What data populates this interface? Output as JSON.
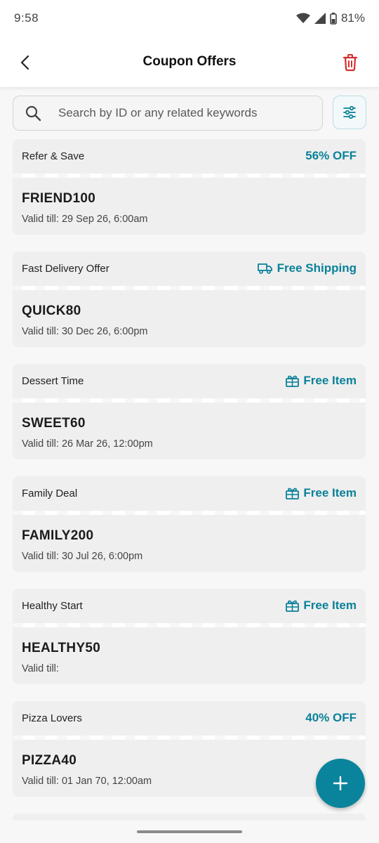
{
  "status_bar": {
    "time": "9:58",
    "battery": "81%"
  },
  "header": {
    "title": "Coupon Offers",
    "back_icon": "chevron-left-icon",
    "delete_icon": "trash-icon"
  },
  "search": {
    "placeholder": "Search by ID or any related keywords",
    "value": ""
  },
  "colors": {
    "accent": "#0a8199",
    "delete": "#d32f2f",
    "card": "#efefef",
    "fab": "#0a849c"
  },
  "coupons": [
    {
      "name": "Refer & Save",
      "offer": "56% OFF",
      "offer_icon": "",
      "code": "FRIEND100",
      "valid": "Valid till: 29 Sep 26, 6:00am"
    },
    {
      "name": "Fast Delivery Offer",
      "offer": "Free Shipping",
      "offer_icon": "truck-icon",
      "code": "QUICK80",
      "valid": "Valid till: 30 Dec 26, 6:00pm"
    },
    {
      "name": "Dessert Time",
      "offer": "Free Item",
      "offer_icon": "gift-icon",
      "code": "SWEET60",
      "valid": "Valid till: 26 Mar 26, 12:00pm"
    },
    {
      "name": "Family Deal",
      "offer": "Free Item",
      "offer_icon": "gift-icon",
      "code": "FAMILY200",
      "valid": "Valid till: 30 Jul 26, 6:00pm"
    },
    {
      "name": "Healthy Start",
      "offer": "Free Item",
      "offer_icon": "gift-icon",
      "code": "HEALTHY50",
      "valid": "Valid till:"
    },
    {
      "name": "Pizza Lovers",
      "offer": "40% OFF",
      "offer_icon": "",
      "code": "PIZZA40",
      "valid": "Valid till: 01 Jan 70, 12:00am"
    }
  ],
  "fab": {
    "icon": "plus-icon"
  }
}
